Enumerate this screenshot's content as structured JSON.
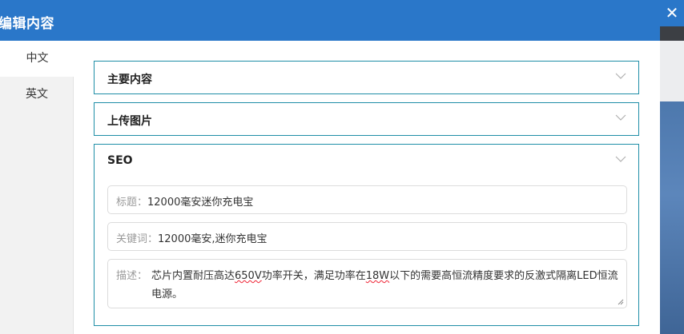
{
  "dialog": {
    "title": "编辑内容",
    "close_glyph": "✕"
  },
  "tabs": [
    {
      "label": "中文",
      "active": true
    },
    {
      "label": "英文",
      "active": false
    }
  ],
  "panels": {
    "main": {
      "title": "主要内容"
    },
    "upload": {
      "title": "上传图片"
    },
    "seo": {
      "title": "SEO"
    }
  },
  "seo": {
    "title_label": "标题：",
    "title_value": "12000毫安迷你充电宝",
    "keywords_label": "关键词：",
    "keywords_value": "12000毫安,迷你充电宝",
    "desc_label": "描述：",
    "desc_before": "芯片内置耐压高达",
    "desc_spell1": "650V",
    "desc_mid": "功率开关，满足功率在",
    "desc_spell2": "18W",
    "desc_after": "以下的需要高恒流精度要求的反激式隔离LED恒流电源。"
  },
  "icons": {
    "close": "close-icon",
    "chevron": "chevron-down-icon"
  },
  "colors": {
    "header": "#2a77c9",
    "panel_border": "#1f8ea7",
    "sidebar": "#f2f2f2"
  }
}
